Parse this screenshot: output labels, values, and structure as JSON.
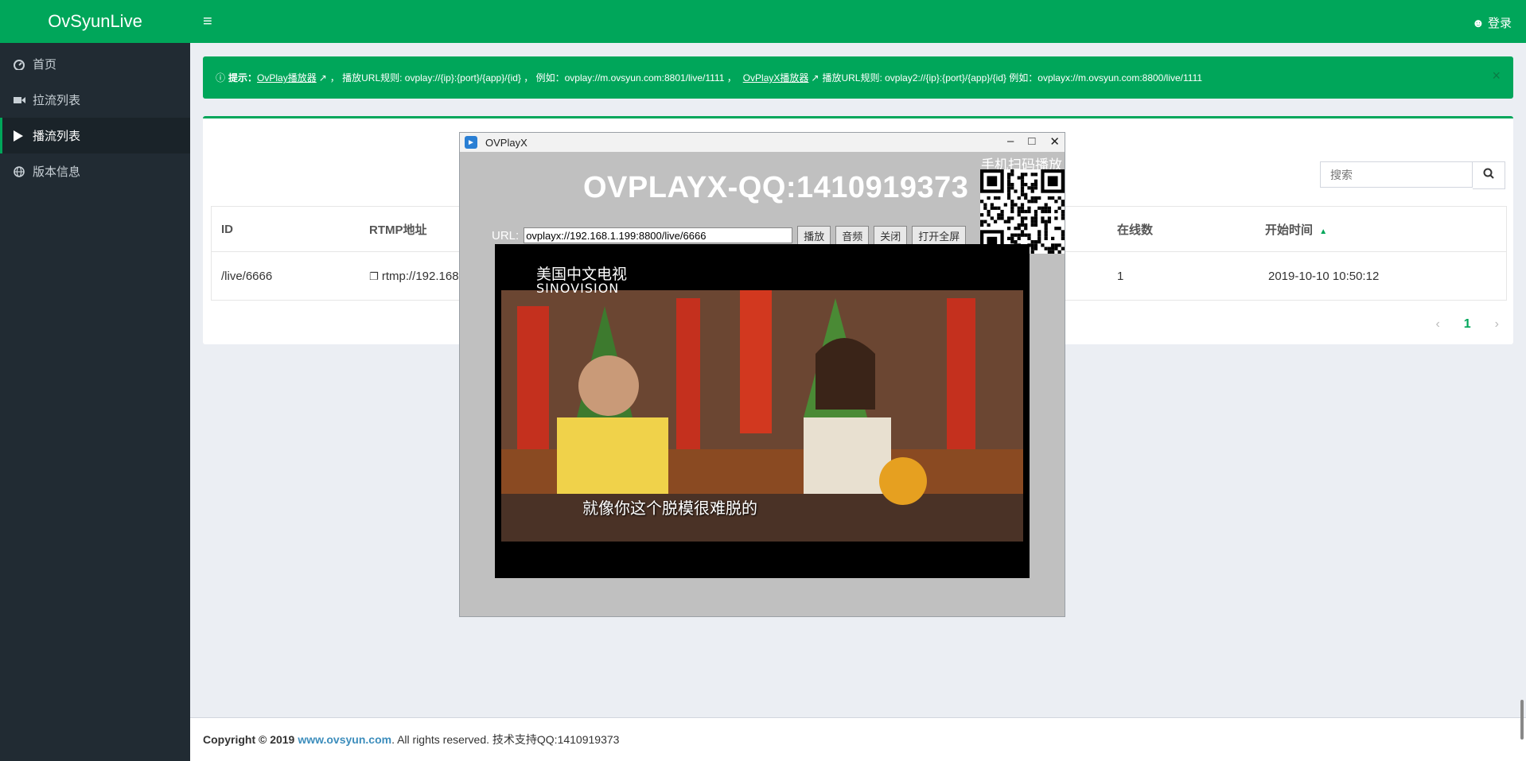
{
  "app": {
    "logo": "OvSyunLive",
    "login": "登录"
  },
  "sidebar": {
    "items": [
      {
        "label": "首页",
        "icon": "dashboard-icon"
      },
      {
        "label": "拉流列表",
        "icon": "video-camera-icon"
      },
      {
        "label": "播流列表",
        "icon": "play-icon"
      },
      {
        "label": "版本信息",
        "icon": "globe-icon"
      }
    ]
  },
  "alert": {
    "prefix": "提示：",
    "link1": "OvPlay播放器",
    "text1": "， 播放URL规则: ovplay://{ip}:{port}/{app}/{id} ， 例如：ovplay://m.ovsyun.com:8801/live/1111 ，",
    "link2": "OvPlayX播放器",
    "text2": "播放URL规则: ovplay2://{ip}:{port}/{app}/{id} 例如：ovplayx://m.ovsyun.com:8800/live/1111",
    "close": "×"
  },
  "search": {
    "placeholder": "搜索"
  },
  "table": {
    "headers": {
      "id": "ID",
      "rtmp": "RTMP地址",
      "online": "在线数",
      "start": "开始时间"
    },
    "rows": [
      {
        "id": "/live/6666",
        "rtmp": "rtmp://192.168",
        "online": "1",
        "start": "2019-10-10 10:50:12"
      }
    ]
  },
  "pagination": {
    "prev": "‹",
    "current": "1",
    "next": "›"
  },
  "footer": {
    "copyright": "Copyright © 2019",
    "site": "www.ovsyun.com",
    "rest": ". All rights reserved. 技术支持QQ:1410919373"
  },
  "player": {
    "window_title": "OVPlayX",
    "title": "OVPLAYX-QQ:1410919373",
    "qr_label": "手机扫码播放",
    "url_label": "URL:",
    "url_value": "ovplayx://192.168.1.199:8800/live/6666",
    "buttons": {
      "play": "播放",
      "audio": "音频",
      "close": "关闭",
      "fullscreen": "打开全屏"
    },
    "channel_cn": "美国中文电视",
    "channel_en": "SINOVISION",
    "caption": "就像你这个脱模很难脱的"
  },
  "colors": {
    "brand": "#00a65a",
    "sidebar": "#212b33",
    "link": "#3c8dbc"
  }
}
